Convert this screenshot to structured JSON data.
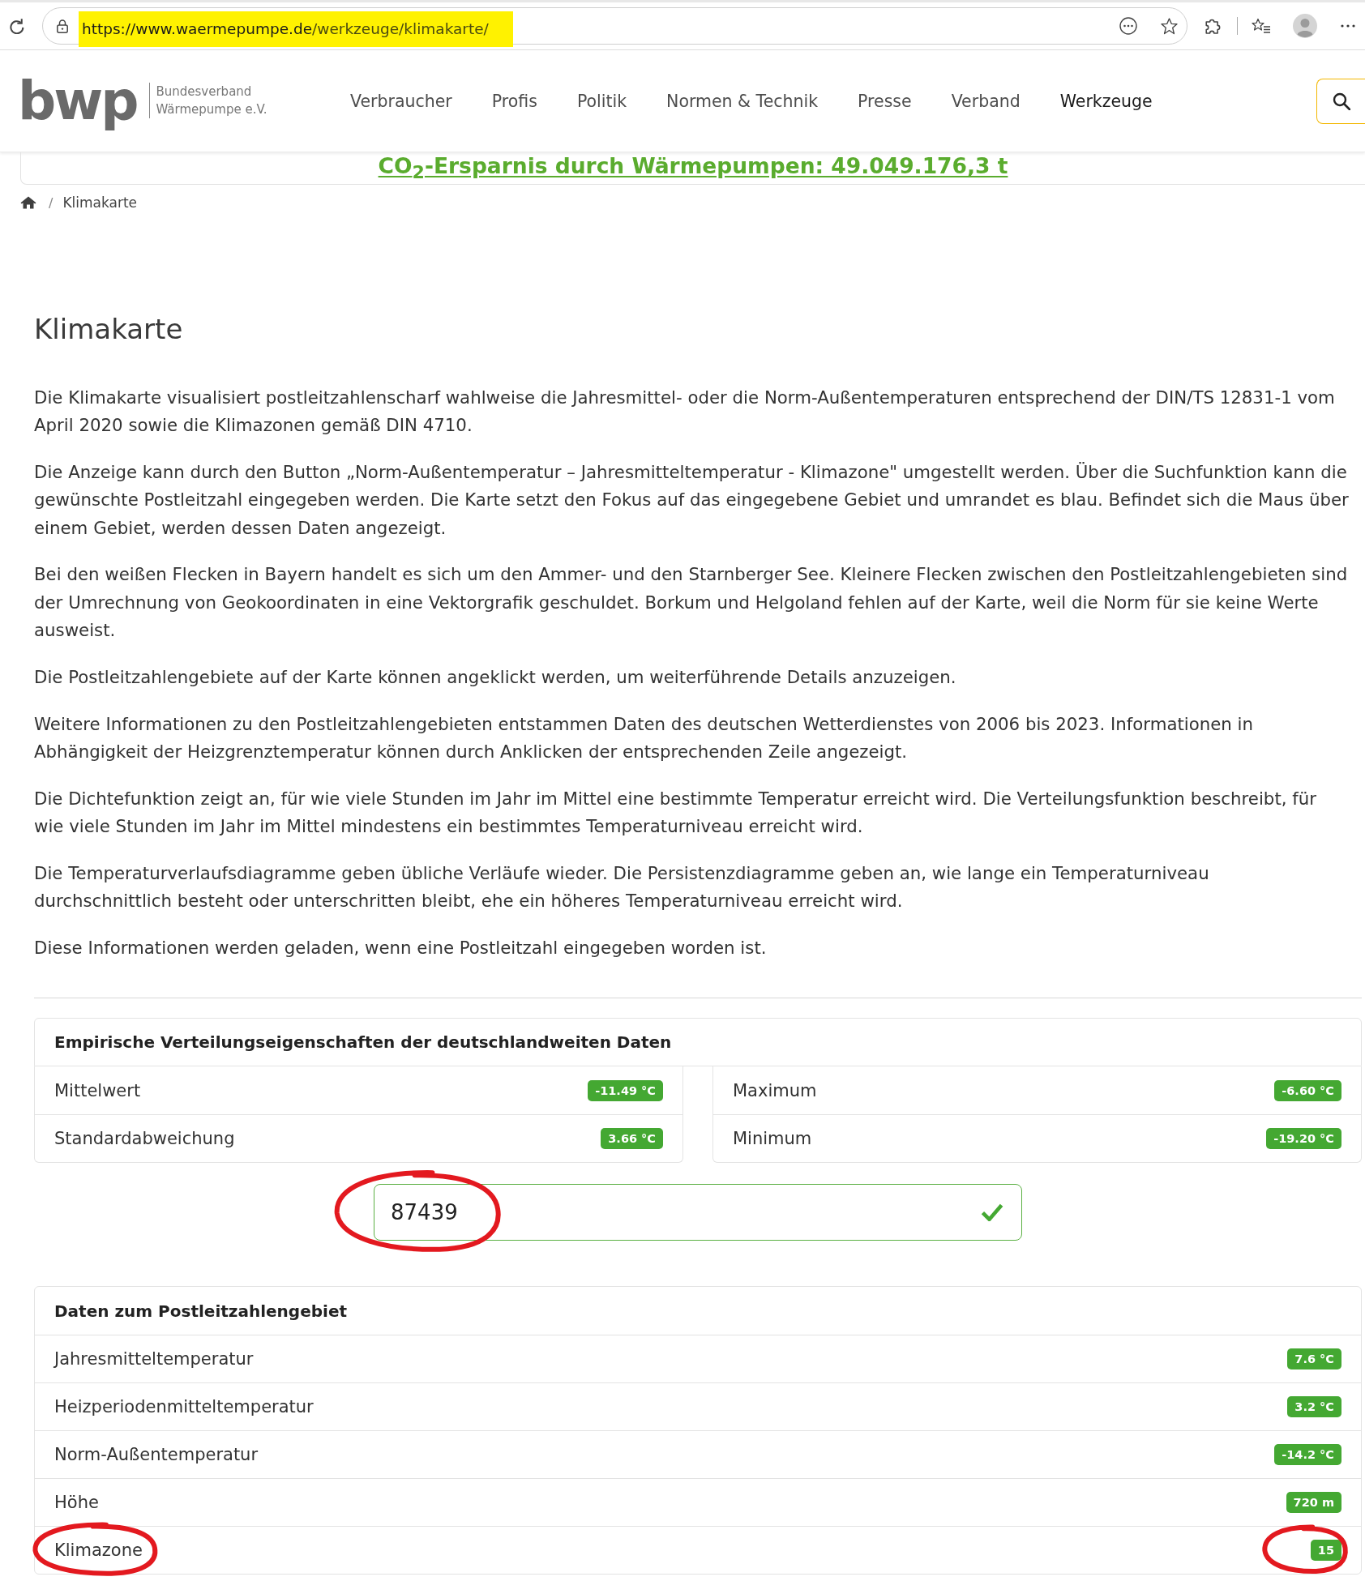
{
  "browser": {
    "address": {
      "host": "https://www.waermepumpe.de",
      "path": "/werkzeuge/klimakarte/",
      "highlighted": true
    }
  },
  "site_header": {
    "logo": {
      "mark": "bwp",
      "lines": [
        "Bundesverband",
        "Wärmepumpe e.V."
      ]
    },
    "nav": [
      {
        "label": "Verbraucher",
        "selected": false
      },
      {
        "label": "Profis",
        "selected": false
      },
      {
        "label": "Politik",
        "selected": false
      },
      {
        "label": "Normen & Technik",
        "selected": false
      },
      {
        "label": "Presse",
        "selected": false
      },
      {
        "label": "Verband",
        "selected": false
      },
      {
        "label": "Werkzeuge",
        "selected": true
      }
    ]
  },
  "banner": {
    "text": "CO$_{2}$-Ersparnis durch Wärmepumpen: 49.049.176,3 t"
  },
  "breadcrumb": {
    "separator": "/",
    "current": "Klimakarte"
  },
  "title": "Klimakarte",
  "paragraphs": [
    "Die Klimakarte visualisiert postleitzahlenscharf wahlweise die Jahresmittel- oder die Norm-Außentemperaturen entsprechend der DIN/TS 12831-1 vom April 2020 sowie die Klimazonen gemäß DIN 4710.",
    "Die Anzeige kann durch den Button „Norm-Außentemperatur – Jahresmitteltemperatur - Klimazone\" umgestellt werden. Über die Suchfunktion kann die gewünschte Postleitzahl eingegeben werden. Die Karte setzt den Fokus auf das eingegebene Gebiet und umrandet es blau. Befindet sich die Maus über einem Gebiet, werden dessen Daten angezeigt.",
    "Bei den weißen Flecken in Bayern handelt es sich um den Ammer- und den Starnberger See. Kleinere Flecken zwischen den Postleitzahlengebieten sind der Umrechnung von Geokoordinaten in eine Vektorgrafik geschuldet. Borkum und Helgoland fehlen auf der Karte, weil die Norm für sie keine Werte ausweist.",
    "Die Postleitzahlengebiete auf der Karte können angeklickt werden, um weiterführende Details anzuzeigen.",
    "Weitere Informationen zu den Postleitzahlengebieten entstammen Daten des deutschen Wetterdienstes von 2006 bis 2023. Informationen in Abhängigkeit der Heizgrenztemperatur können durch Anklicken der entsprechenden Zeile angezeigt.",
    "Die Dichtefunktion zeigt an, für wie viele Stunden im Jahr im Mittel eine bestimmte Temperatur erreicht wird. Die Verteilungsfunktion beschreibt, für wie viele Stunden im Jahr im Mittel mindestens ein bestimmtes Temperaturniveau erreicht wird.",
    "Die Temperaturverlaufsdiagramme geben übliche Verläufe wieder. Die Persistenzdiagramme geben an, wie lange ein Temperaturniveau durchschnittlich besteht oder unterschritten bleibt, ehe ein höheres Temperaturniveau erreicht wird.",
    "Diese Informationen werden geladen, wenn eine Postleitzahl eingegeben worden ist."
  ],
  "stats_card": {
    "title": "Empirische Verteilungseigenschaften der deutschlandweiten Daten",
    "columns": [
      [
        {
          "label": "Mittelwert",
          "value": "-11.49 °C"
        },
        {
          "label": "Standardabweichung",
          "value": "3.66 °C"
        }
      ],
      [
        {
          "label": "Maximum",
          "value": "-6.60 °C"
        },
        {
          "label": "Minimum",
          "value": "-19.20 °C"
        }
      ]
    ]
  },
  "postcode_field": {
    "value": "87439",
    "valid": true,
    "circled": true
  },
  "area_card": {
    "title": "Daten zum Postleitzahlengebiet",
    "rows": [
      {
        "label": "Jahresmitteltemperatur",
        "value": "7.6 °C",
        "label_circled": false,
        "value_circled": false
      },
      {
        "label": "Heizperiodenmitteltemperatur",
        "value": "3.2 °C",
        "label_circled": false,
        "value_circled": false
      },
      {
        "label": "Norm-Außentemperatur",
        "value": "-14.2 °C",
        "label_circled": false,
        "value_circled": false
      },
      {
        "label": "Höhe",
        "value": "720 m",
        "label_circled": false,
        "value_circled": false
      },
      {
        "label": "Klimazone",
        "value": "15",
        "label_circled": true,
        "value_circled": true
      }
    ]
  }
}
